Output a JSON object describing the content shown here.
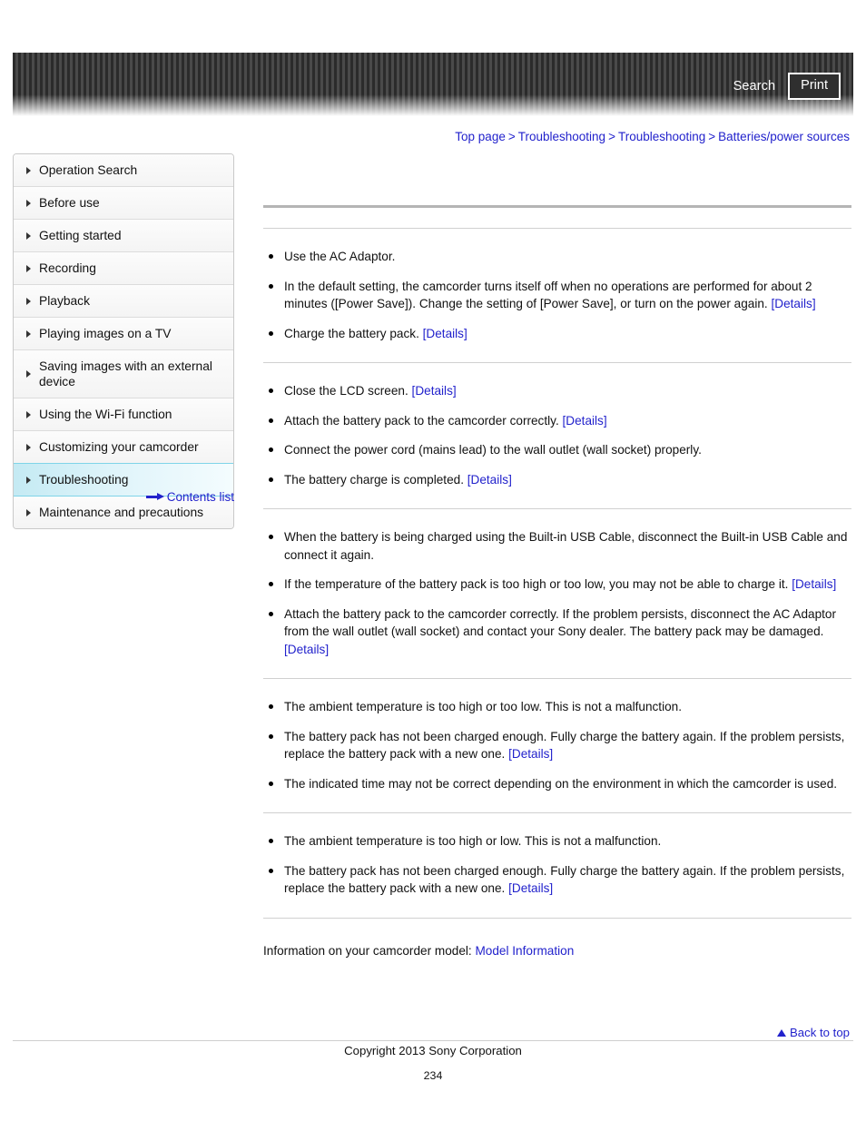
{
  "header": {
    "search_label": "Search",
    "print_label": "Print"
  },
  "breadcrumb": {
    "separator": ">",
    "items": [
      {
        "label": "Top page"
      },
      {
        "label": "Troubleshooting"
      },
      {
        "label": "Troubleshooting"
      },
      {
        "label": "Batteries/power sources"
      }
    ]
  },
  "sidebar": {
    "items": [
      {
        "label": "Operation Search",
        "active": false
      },
      {
        "label": "Before use",
        "active": false
      },
      {
        "label": "Getting started",
        "active": false
      },
      {
        "label": "Recording",
        "active": false
      },
      {
        "label": "Playback",
        "active": false
      },
      {
        "label": "Playing images on a TV",
        "active": false
      },
      {
        "label": "Saving images with an external device",
        "active": false
      },
      {
        "label": "Using the Wi-Fi function",
        "active": false
      },
      {
        "label": "Customizing your camcorder",
        "active": false
      },
      {
        "label": "Troubleshooting",
        "active": true
      },
      {
        "label": "Maintenance and precautions",
        "active": false
      }
    ],
    "contents_list_label": "Contents list"
  },
  "main": {
    "page_title": "",
    "section_title": "",
    "sections": [
      {
        "bullets": [
          {
            "text": "Use the AC Adaptor.",
            "link": ""
          },
          {
            "text": "In the default setting, the camcorder turns itself off when no operations are performed for about 2 minutes ([Power Save]). Change the setting of [Power Save], or turn on the power again.",
            "link": "[Details]"
          },
          {
            "text": "Charge the battery pack.",
            "link": "[Details]"
          }
        ]
      },
      {
        "bullets": [
          {
            "text": "Close the LCD screen.",
            "link": "[Details]"
          },
          {
            "text": "Attach the battery pack to the camcorder correctly.",
            "link": "[Details]"
          },
          {
            "text": "Connect the power cord (mains lead) to the wall outlet (wall socket) properly.",
            "link": ""
          },
          {
            "text": "The battery charge is completed.",
            "link": "[Details]"
          }
        ]
      },
      {
        "bullets": [
          {
            "text": "When the battery is being charged using the Built-in USB Cable, disconnect the Built-in USB Cable and connect it again.",
            "link": ""
          },
          {
            "text": "If the temperature of the battery pack is too high or too low, you may not be able to charge it.",
            "link": "[Details]"
          },
          {
            "text": "Attach the battery pack to the camcorder correctly. If the problem persists, disconnect the AC Adaptor from the wall outlet (wall socket) and contact your Sony dealer. The battery pack may be damaged.",
            "link": "[Details]"
          }
        ]
      },
      {
        "bullets": [
          {
            "text": "The ambient temperature is too high or too low. This is not a malfunction.",
            "link": ""
          },
          {
            "text": "The battery pack has not been charged enough. Fully charge the battery again. If the problem persists, replace the battery pack with a new one.",
            "link": "[Details]"
          },
          {
            "text": "The indicated time may not be correct depending on the environment in which the camcorder is used.",
            "link": ""
          }
        ]
      },
      {
        "bullets": [
          {
            "text": "The ambient temperature is too high or low. This is not a malfunction.",
            "link": ""
          },
          {
            "text": "The battery pack has not been charged enough. Fully charge the battery again. If the problem persists, replace the battery pack with a new one.",
            "link": "[Details]"
          }
        ]
      }
    ],
    "model_info_prefix": "Information on your camcorder model:",
    "model_info_link": "Model Information"
  },
  "footer": {
    "back_to_top_label": "Back to top",
    "copyright": "Copyright 2013 Sony Corporation",
    "page_number": "234"
  },
  "colors": {
    "link": "#2222cc",
    "active_highlight": "#c4eaf3",
    "header_dark": "#2b2b2b",
    "rule": "#d0d0d0"
  }
}
